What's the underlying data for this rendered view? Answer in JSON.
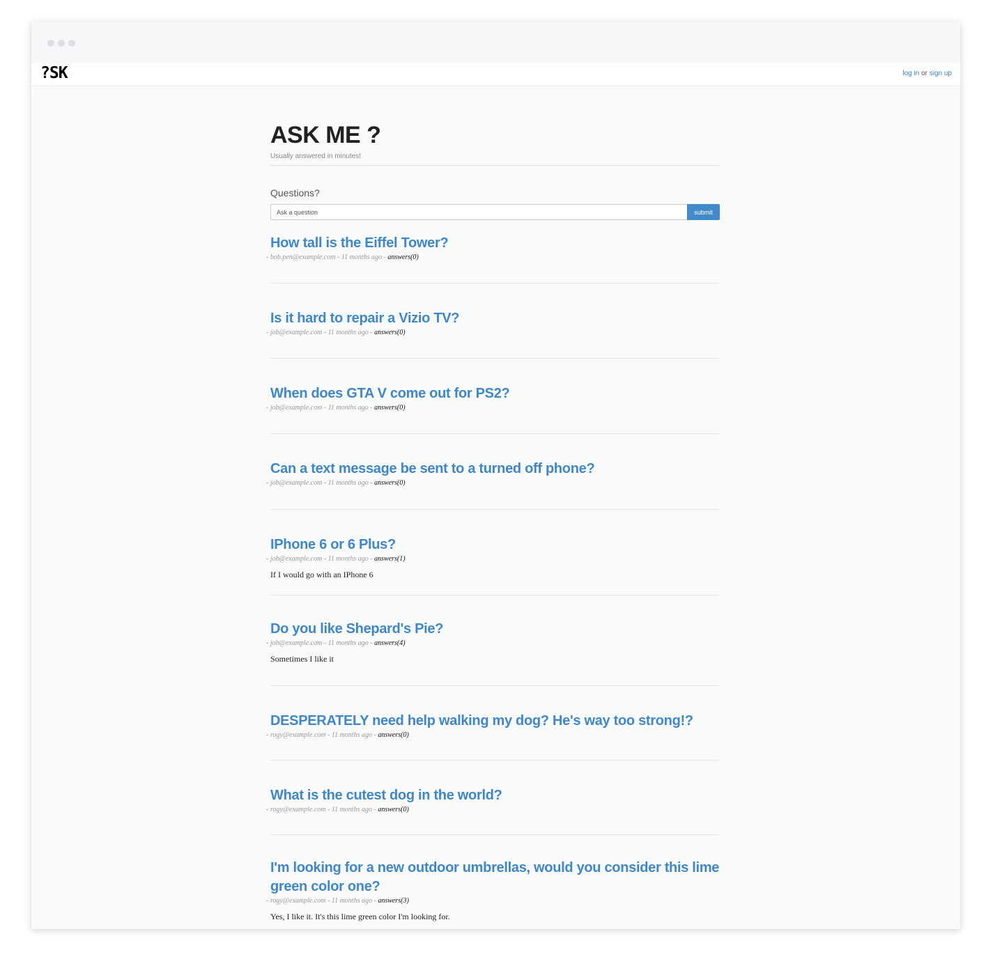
{
  "navbar": {
    "logo": "?SK",
    "login_label": "log in",
    "or_label": "or",
    "signup_label": "sign up"
  },
  "header": {
    "title": "ASK ME ?",
    "subtitle": "Usually answered in minutes!"
  },
  "form": {
    "label": "Questions?",
    "placeholder": "Ask a question",
    "submit_label": "submit"
  },
  "questions": [
    {
      "title": "How tall is the Eiffel Tower?",
      "author": "bob.pen@example.com",
      "time": "11 months ago",
      "answers": "answers(0)",
      "answer_text": ""
    },
    {
      "title": "Is it hard to repair a Vizio TV?",
      "author": "job@example.com",
      "time": "11 months ago",
      "answers": "answers(0)",
      "answer_text": ""
    },
    {
      "title": "When does GTA V come out for PS2?",
      "author": "job@example.com",
      "time": "11 months ago",
      "answers": "answers(0)",
      "answer_text": ""
    },
    {
      "title": "Can a text message be sent to a turned off phone?",
      "author": "job@example.com",
      "time": "11 months ago",
      "answers": "answers(0)",
      "answer_text": ""
    },
    {
      "title": "IPhone 6 or 6 Plus?",
      "author": "job@example.com",
      "time": "11 months ago",
      "answers": "answers(1)",
      "answer_text": "If I would go with an IPhone 6"
    },
    {
      "title": "Do you like Shepard's Pie?",
      "author": "job@example.com",
      "time": "11 months ago",
      "answers": "answers(4)",
      "answer_text": "Sometimes I like it"
    },
    {
      "title": "DESPERATELY need help walking my dog? He's way too strong!?",
      "author": "rogy@example.com",
      "time": "11 months ago",
      "answers": "answers(0)",
      "answer_text": ""
    },
    {
      "title": "What is the cutest dog in the world?",
      "author": "rogy@example.com",
      "time": "11 months ago",
      "answers": "answers(0)",
      "answer_text": ""
    },
    {
      "title": "I'm looking for a new outdoor umbrellas, would you consider this lime green color one?",
      "author": "rogy@example.com",
      "time": "11 months ago",
      "answers": "answers(3)",
      "answer_text": "Yes, I like it. It's this lime green color I'm looking for."
    }
  ]
}
